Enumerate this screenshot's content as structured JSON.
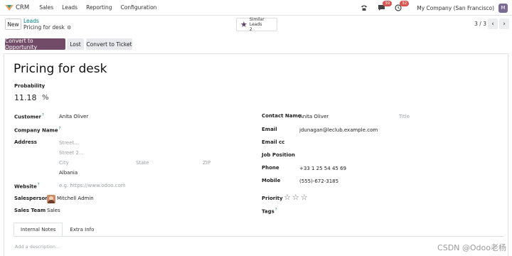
{
  "nav": {
    "app_name": "CRM",
    "menu": [
      "Sales",
      "Leads",
      "Reporting",
      "Configuration"
    ],
    "messages_badge": "39",
    "activities_badge": "32",
    "company": "My Company (San Francisco)",
    "user_initial": "M"
  },
  "control": {
    "new_label": "New",
    "breadcrumb_parent": "Leads",
    "breadcrumb_current": "Pricing for desk",
    "smart_button_title": "Similar Leads",
    "smart_button_count": "2",
    "pager": "3 / 3"
  },
  "status": {
    "convert_opportunity": "Convert to Opportunity",
    "lost": "Lost",
    "convert_ticket": "Convert to Ticket"
  },
  "form": {
    "title": "Pricing for desk",
    "probability_label": "Probability",
    "probability_value": "11.18",
    "probability_unit": "%",
    "customer_label": "Customer",
    "customer_value": "Anita Oliver",
    "company_name_label": "Company Name",
    "address_label": "Address",
    "street_ph": "Street...",
    "street2_ph": "Street 2...",
    "city_ph": "City",
    "state_ph": "State",
    "zip_ph": "ZIP",
    "country_value": "Albania",
    "website_label": "Website",
    "website_ph": "e.g. https://www.odoo.com",
    "salesperson_label": "Salesperson",
    "salesperson_value": "Mitchell Admin",
    "sales_team_label": "Sales Team",
    "sales_team_value": "Sales",
    "contact_name_label": "Contact Name",
    "contact_name_value": "Anita Oliver",
    "title_ph": "Title",
    "email_label": "Email",
    "email_value": "jdunagan@leclub.example.com",
    "email_cc_label": "Email cc",
    "job_position_label": "Job Position",
    "phone_label": "Phone",
    "phone_value": "+33 1 25 54 45 69",
    "mobile_label": "Mobile",
    "mobile_value": "(555)-672-3185",
    "priority_label": "Priority",
    "priority_value": 0,
    "priority_max": 3,
    "tags_label": "Tags"
  },
  "tabs": [
    "Internal Notes",
    "Extra Info"
  ],
  "description_ph": "Add a description...",
  "watermark": "CSDN @Odoo老杨",
  "colors": {
    "brand": "#714b67",
    "link": "#017e84",
    "badge": "#d9534f"
  }
}
